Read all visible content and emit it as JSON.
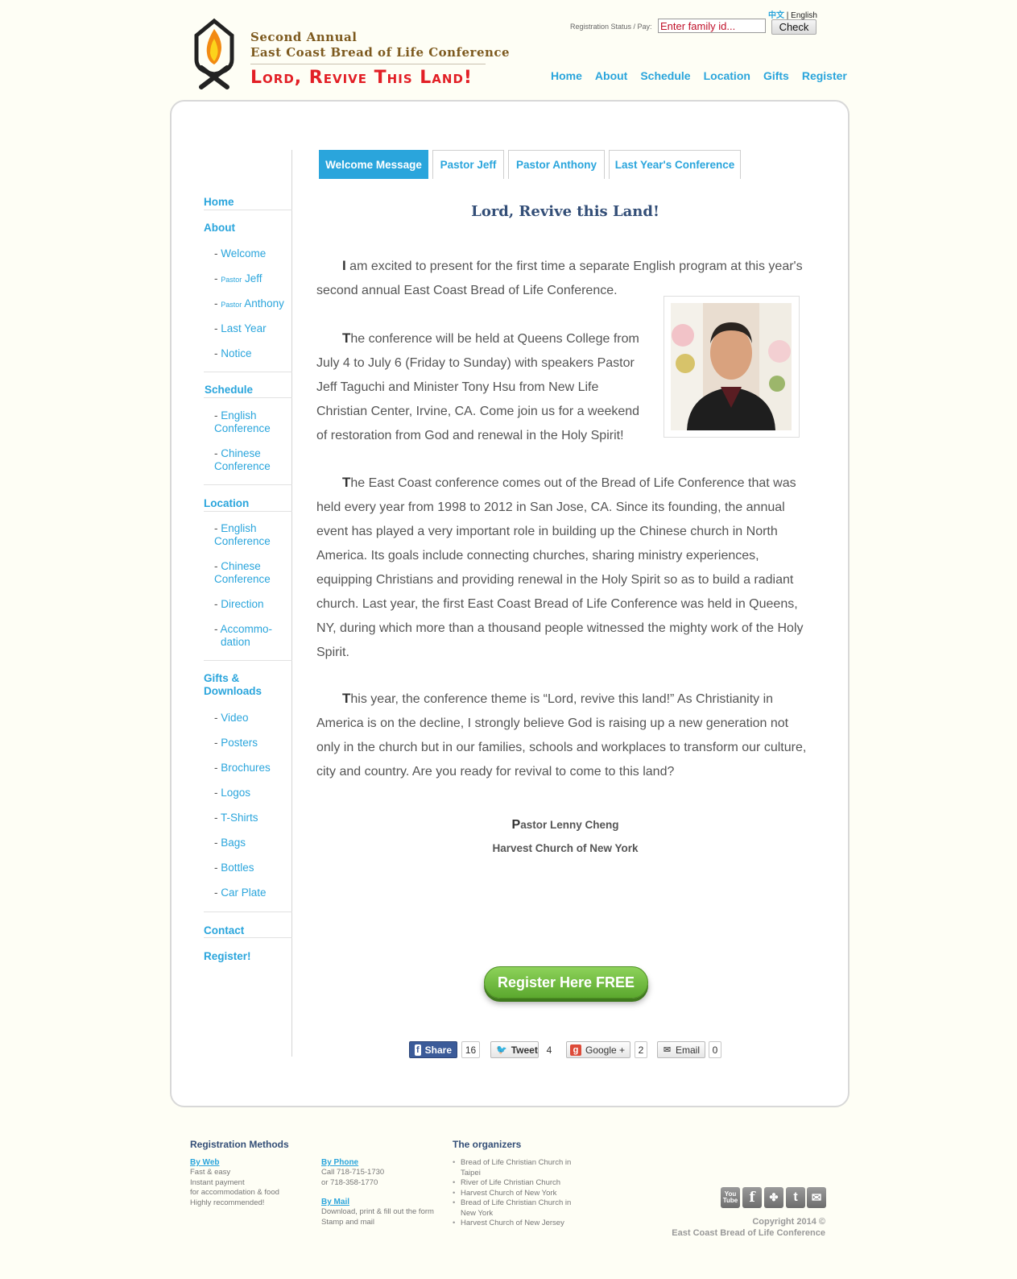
{
  "header": {
    "brand_line1": "Second Annual",
    "brand_line2": "East Coast Bread of Life Conference",
    "slogan": "Lord, Revive This Land!",
    "lang_zh": "中文",
    "lang_sep": "|",
    "lang_en": "English",
    "reg_status_label": "Registration Status / Pay:",
    "family_id_placeholder": "Enter family id...",
    "check_label": "Check",
    "nav": [
      "Home",
      "About",
      "Schedule",
      "Location",
      "Gifts",
      "Register"
    ]
  },
  "sidebar": {
    "home": "Home",
    "about": "About",
    "about_items": {
      "welcome": "Welcome",
      "pastor_prefix": "Pastor",
      "jeff": "Jeff",
      "anthony": "Anthony",
      "last_year": "Last Year",
      "notice": "Notice"
    },
    "schedule": "Schedule",
    "schedule_items": [
      "English",
      "Conference",
      "Chinese",
      "Conference"
    ],
    "location": "Location",
    "location_items": [
      "English",
      "Conference",
      "Chinese",
      "Conference",
      "Direction",
      "Accommo-",
      "dation"
    ],
    "gifts_line1": "Gifts &",
    "gifts_line2": "Downloads",
    "gifts_items": [
      "Video",
      "Posters",
      "Brochures",
      "Logos",
      "T-Shirts",
      "Bags",
      "Bottles",
      "Car Plate"
    ],
    "contact": "Contact",
    "register": "Register!",
    "dash": "-"
  },
  "tabs": [
    "Welcome Message",
    "Pastor Jeff",
    "Pastor Anthony",
    "Last Year's Conference"
  ],
  "content": {
    "title": "Lord, Revive this Land!",
    "p1_cap": "I",
    "p1": " am excited to present for the first time a separate English program at this year's second annual East Coast Bread of Life Conference.",
    "p2_cap": "T",
    "p2": "he conference will be held at Queens College from July 4 to July 6 (Friday to Sunday) with speakers Pastor Jeff Taguchi and Minister Tony Hsu from New Life Christian Center, Irvine, CA. Come join us for a weekend of restoration from God and renewal in the Holy Spirit!",
    "p3_cap": "T",
    "p3": "he East Coast conference comes out of the Bread of Life Conference that was held every year from 1998 to 2012 in San Jose, CA. Since its founding, the annual event has played a very important role in building up the Chinese church in North America. Its goals include connecting churches, sharing ministry experiences, equipping Christians and providing renewal in the Holy Spirit so as to build a radiant church. Last year, the first East Coast Bread of Life Conference was held in Queens, NY, during which more than a thousand people witnessed the mighty work of the Holy Spirit.",
    "p4_cap": "T",
    "p4": "his year, the conference theme is “Lord, revive this land!” As Christianity in America is on the decline, I strongly believe God is raising up a new generation not only in the church but in our families, schools and workplaces to transform our culture, city and country. Are you ready for revival to come to this land?",
    "sig_cap": "P",
    "sig_name": "astor Lenny Cheng",
    "sig_church": "Harvest Church of New York",
    "register_button": "Register Here FREE"
  },
  "share": {
    "fb_label": "Share",
    "fb_count": "16",
    "tweet_label": "Tweet",
    "tweet_count": "4",
    "gplus_label": "Google +",
    "gplus_count": "2",
    "email_label": "Email",
    "email_count": "0",
    "colors": {
      "facebook": "#3b5b99",
      "twitter": "#2aa5dc",
      "gplus": "#dd4b39"
    }
  },
  "footer": {
    "reg_heading": "Registration Methods",
    "web_link": "By Web",
    "web_lines": [
      "Fast & easy",
      "Instant payment",
      "for accommodation & food",
      "Highly recommended!"
    ],
    "phone_link": "By Phone",
    "phone_lines": [
      "Call 718-715-1730",
      "or 718-358-1770"
    ],
    "mail_link": "By Mail",
    "mail_lines": [
      "Download, print & fill out the form",
      "Stamp and mail"
    ],
    "org_heading": "The organizers",
    "organizers": [
      "Bread of Life Christian Church in Taipei",
      "River of Life Christian Church",
      "Harvest Church of New York",
      "Bread of Life Christian Church in New York",
      "Harvest Church of New Jersey"
    ],
    "social_icons": [
      "youtube-icon",
      "facebook-icon",
      "myspace-icon",
      "twitter-icon",
      "email-icon"
    ],
    "copyright_line1": "Copyright 2014 ©",
    "copyright_line2": "East Coast Bread of Life Conference"
  },
  "colors": {
    "accent": "#2aa5dc",
    "brand_red": "#e21f26",
    "brand_brown": "#7d5a1f",
    "title_navy": "#334e77",
    "register_green": "#5ba82e"
  }
}
